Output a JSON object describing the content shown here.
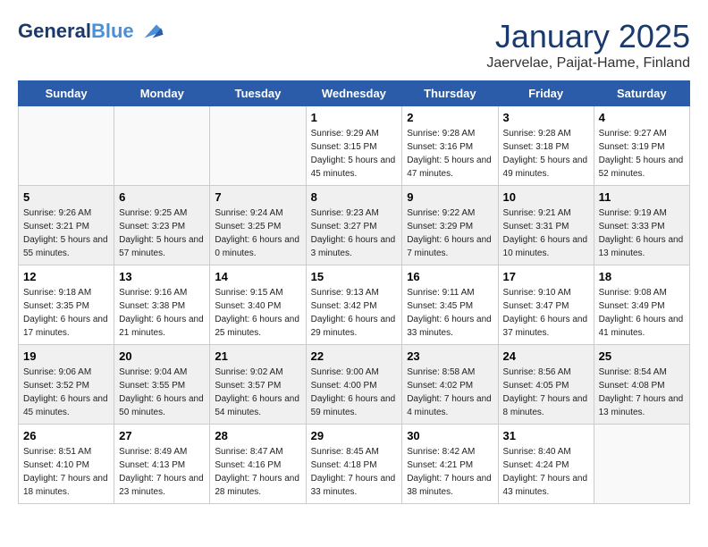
{
  "header": {
    "logo_line1": "General",
    "logo_line2": "Blue",
    "month_title": "January 2025",
    "subtitle": "Jaervelae, Paijat-Hame, Finland"
  },
  "days_of_week": [
    "Sunday",
    "Monday",
    "Tuesday",
    "Wednesday",
    "Thursday",
    "Friday",
    "Saturday"
  ],
  "weeks": [
    [
      {
        "day": "",
        "info": ""
      },
      {
        "day": "",
        "info": ""
      },
      {
        "day": "",
        "info": ""
      },
      {
        "day": "1",
        "info": "Sunrise: 9:29 AM\nSunset: 3:15 PM\nDaylight: 5 hours and 45 minutes."
      },
      {
        "day": "2",
        "info": "Sunrise: 9:28 AM\nSunset: 3:16 PM\nDaylight: 5 hours and 47 minutes."
      },
      {
        "day": "3",
        "info": "Sunrise: 9:28 AM\nSunset: 3:18 PM\nDaylight: 5 hours and 49 minutes."
      },
      {
        "day": "4",
        "info": "Sunrise: 9:27 AM\nSunset: 3:19 PM\nDaylight: 5 hours and 52 minutes."
      }
    ],
    [
      {
        "day": "5",
        "info": "Sunrise: 9:26 AM\nSunset: 3:21 PM\nDaylight: 5 hours and 55 minutes."
      },
      {
        "day": "6",
        "info": "Sunrise: 9:25 AM\nSunset: 3:23 PM\nDaylight: 5 hours and 57 minutes."
      },
      {
        "day": "7",
        "info": "Sunrise: 9:24 AM\nSunset: 3:25 PM\nDaylight: 6 hours and 0 minutes."
      },
      {
        "day": "8",
        "info": "Sunrise: 9:23 AM\nSunset: 3:27 PM\nDaylight: 6 hours and 3 minutes."
      },
      {
        "day": "9",
        "info": "Sunrise: 9:22 AM\nSunset: 3:29 PM\nDaylight: 6 hours and 7 minutes."
      },
      {
        "day": "10",
        "info": "Sunrise: 9:21 AM\nSunset: 3:31 PM\nDaylight: 6 hours and 10 minutes."
      },
      {
        "day": "11",
        "info": "Sunrise: 9:19 AM\nSunset: 3:33 PM\nDaylight: 6 hours and 13 minutes."
      }
    ],
    [
      {
        "day": "12",
        "info": "Sunrise: 9:18 AM\nSunset: 3:35 PM\nDaylight: 6 hours and 17 minutes."
      },
      {
        "day": "13",
        "info": "Sunrise: 9:16 AM\nSunset: 3:38 PM\nDaylight: 6 hours and 21 minutes."
      },
      {
        "day": "14",
        "info": "Sunrise: 9:15 AM\nSunset: 3:40 PM\nDaylight: 6 hours and 25 minutes."
      },
      {
        "day": "15",
        "info": "Sunrise: 9:13 AM\nSunset: 3:42 PM\nDaylight: 6 hours and 29 minutes."
      },
      {
        "day": "16",
        "info": "Sunrise: 9:11 AM\nSunset: 3:45 PM\nDaylight: 6 hours and 33 minutes."
      },
      {
        "day": "17",
        "info": "Sunrise: 9:10 AM\nSunset: 3:47 PM\nDaylight: 6 hours and 37 minutes."
      },
      {
        "day": "18",
        "info": "Sunrise: 9:08 AM\nSunset: 3:49 PM\nDaylight: 6 hours and 41 minutes."
      }
    ],
    [
      {
        "day": "19",
        "info": "Sunrise: 9:06 AM\nSunset: 3:52 PM\nDaylight: 6 hours and 45 minutes."
      },
      {
        "day": "20",
        "info": "Sunrise: 9:04 AM\nSunset: 3:55 PM\nDaylight: 6 hours and 50 minutes."
      },
      {
        "day": "21",
        "info": "Sunrise: 9:02 AM\nSunset: 3:57 PM\nDaylight: 6 hours and 54 minutes."
      },
      {
        "day": "22",
        "info": "Sunrise: 9:00 AM\nSunset: 4:00 PM\nDaylight: 6 hours and 59 minutes."
      },
      {
        "day": "23",
        "info": "Sunrise: 8:58 AM\nSunset: 4:02 PM\nDaylight: 7 hours and 4 minutes."
      },
      {
        "day": "24",
        "info": "Sunrise: 8:56 AM\nSunset: 4:05 PM\nDaylight: 7 hours and 8 minutes."
      },
      {
        "day": "25",
        "info": "Sunrise: 8:54 AM\nSunset: 4:08 PM\nDaylight: 7 hours and 13 minutes."
      }
    ],
    [
      {
        "day": "26",
        "info": "Sunrise: 8:51 AM\nSunset: 4:10 PM\nDaylight: 7 hours and 18 minutes."
      },
      {
        "day": "27",
        "info": "Sunrise: 8:49 AM\nSunset: 4:13 PM\nDaylight: 7 hours and 23 minutes."
      },
      {
        "day": "28",
        "info": "Sunrise: 8:47 AM\nSunset: 4:16 PM\nDaylight: 7 hours and 28 minutes."
      },
      {
        "day": "29",
        "info": "Sunrise: 8:45 AM\nSunset: 4:18 PM\nDaylight: 7 hours and 33 minutes."
      },
      {
        "day": "30",
        "info": "Sunrise: 8:42 AM\nSunset: 4:21 PM\nDaylight: 7 hours and 38 minutes."
      },
      {
        "day": "31",
        "info": "Sunrise: 8:40 AM\nSunset: 4:24 PM\nDaylight: 7 hours and 43 minutes."
      },
      {
        "day": "",
        "info": ""
      }
    ]
  ]
}
